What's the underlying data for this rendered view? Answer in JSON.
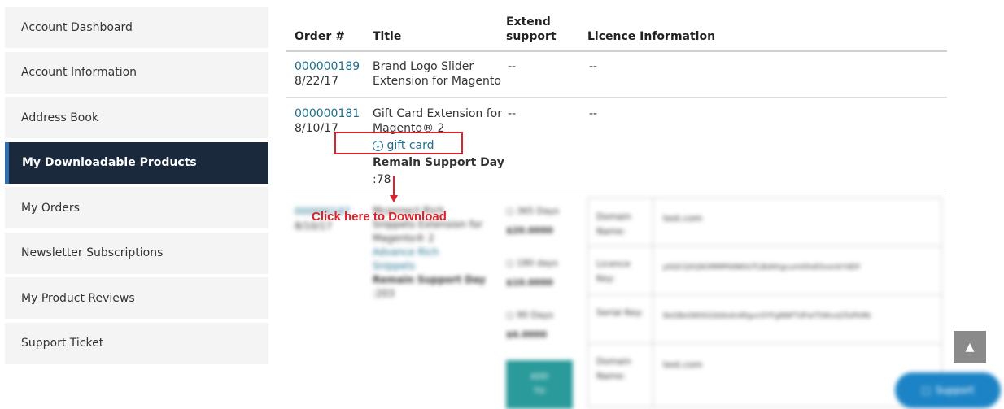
{
  "sidebar": {
    "items": [
      {
        "label": "Account Dashboard"
      },
      {
        "label": "Account Information"
      },
      {
        "label": "Address Book"
      },
      {
        "label": "My Downloadable Products"
      },
      {
        "label": "My Orders"
      },
      {
        "label": "Newsletter Subscriptions"
      },
      {
        "label": "My Product Reviews"
      },
      {
        "label": "Support Ticket"
      }
    ],
    "active_index": 3
  },
  "table": {
    "headers": {
      "order": "Order #",
      "title": "Title",
      "extend_line1": "Extend",
      "extend_line2": "support",
      "licence": "Licence Information"
    },
    "rows": [
      {
        "order_link": "000000189",
        "date": "8/22/17",
        "title_line1": "Brand Logo Slider",
        "title_line2": "Extension for Magento",
        "extend": "--",
        "licence": "--"
      },
      {
        "order_link": "000000181",
        "date": "8/10/17",
        "title_line1": "Gift Card Extension for",
        "title_line2": "Magento® 2",
        "download_link": "gift card",
        "remain_label": "Remain Support Day",
        "remain_value": ":78",
        "extend": "--",
        "licence": "--"
      }
    ]
  },
  "blurred": {
    "order": "000000187",
    "date": "8/10/17",
    "title_line1": "Mconnect Rich",
    "title_line2": "Snippets Extension for",
    "title_line3": "Magento® 2",
    "link_line1": "Advance Rich",
    "link_line2": "Snippets",
    "remain_label": "Remain Support Day",
    "remain_value": ":203",
    "options": [
      {
        "label": "365 Days",
        "price": "$20.0000"
      },
      {
        "label": "180 days",
        "price": "$10.0000"
      },
      {
        "label": "90 Days",
        "price": "$6.0000"
      }
    ],
    "add_button_line1": "ADD",
    "add_button_line2": "TO",
    "licence": [
      {
        "key": "Domain Name:",
        "value": "test.com"
      },
      {
        "key": "Licence Key:",
        "value": "pSQCQXQ6OMMPAINKtUTLBdAhgcum00xE0vonkYdDY"
      },
      {
        "key": "Serial Key:",
        "value": "8eGBe0W0GGbkkdn4Rgvn5YFgNNFTdFwT5WvsQTuPkMk"
      },
      {
        "key": "Domain Name:",
        "value": "test.com"
      }
    ]
  },
  "annotation": {
    "text": "Click here to Download"
  },
  "widgets": {
    "support_label": "Support",
    "scroll_top_glyph": "▲"
  },
  "colors": {
    "active_bg": "#1a2a3c",
    "link": "#1f6f8b",
    "annotation": "#d9232a",
    "support": "#1c84c6"
  }
}
